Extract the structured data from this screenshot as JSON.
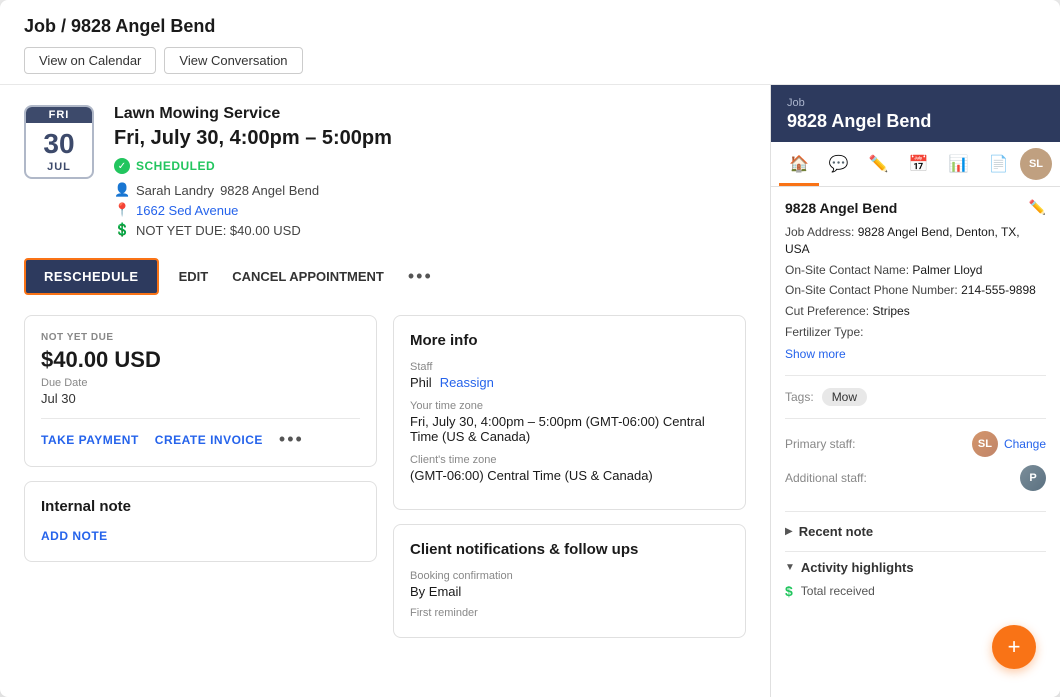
{
  "page": {
    "title": "Job / 9828 Angel Bend"
  },
  "header": {
    "title": "Job / 9828 Angel Bend",
    "btn_calendar": "View on Calendar",
    "btn_conversation": "View Conversation"
  },
  "job": {
    "service_name": "Lawn Mowing Service",
    "time": "Fri, July 30, 4:00pm – 5:00pm",
    "status": "SCHEDULED",
    "client": "Sarah Landry",
    "address_text": "9828 Angel Bend",
    "address_link": "1662 Sed Avenue",
    "balance": "NOT YET DUE: $40.00 USD",
    "calendar": {
      "day_name": "FRI",
      "day_number": "30",
      "month": "JUL"
    }
  },
  "actions": {
    "reschedule": "RESCHEDULE",
    "edit": "EDIT",
    "cancel_appointment": "CANCEL APPOINTMENT",
    "dots": "•••"
  },
  "payment_card": {
    "not_yet_due_label": "NOT YET DUE",
    "amount": "$40.00 USD",
    "due_date_label": "Due Date",
    "due_date_value": "Jul 30",
    "take_payment": "TAKE PAYMENT",
    "create_invoice": "CREATE INVOICE",
    "dots": "•••"
  },
  "note_card": {
    "title": "Internal note",
    "add_note": "ADD NOTE"
  },
  "more_info": {
    "title": "More info",
    "staff_label": "Staff",
    "staff_name": "Phil",
    "reassign": "Reassign",
    "timezone_label": "Your time zone",
    "timezone_value": "Fri, July 30, 4:00pm – 5:00pm (GMT-06:00) Central Time (US & Canada)",
    "client_timezone_label": "Client's time zone",
    "client_timezone_value": "(GMT-06:00) Central Time (US & Canada)"
  },
  "notifications": {
    "title": "Client notifications & follow ups",
    "booking_label": "Booking confirmation",
    "booking_value": "By Email",
    "reminder_label": "First reminder"
  },
  "right_panel": {
    "job_label": "Job",
    "job_name": "9828 Angel Bend",
    "tabs": [
      {
        "name": "home",
        "icon": "🏠",
        "active": true
      },
      {
        "name": "chat",
        "icon": "💬"
      },
      {
        "name": "edit",
        "icon": "✏️"
      },
      {
        "name": "calendar",
        "icon": "📅"
      },
      {
        "name": "reports",
        "icon": "📊"
      },
      {
        "name": "document",
        "icon": "📄"
      }
    ],
    "section_title": "9828 Angel Bend",
    "address": "9828 Angel Bend, Denton, TX, USA",
    "contact_name": "Palmer Lloyd",
    "contact_phone": "214-555-9898",
    "cut_preference": "Stripes",
    "fertilizer_type": "",
    "show_more": "Show more",
    "tags_label": "Tags:",
    "tag": "Mow",
    "primary_staff_label": "Primary staff:",
    "change_label": "Change",
    "additional_staff_label": "Additional staff:",
    "recent_note_label": "Recent note",
    "activity_highlights_label": "Activity highlights",
    "total_received_label": "Total received"
  }
}
